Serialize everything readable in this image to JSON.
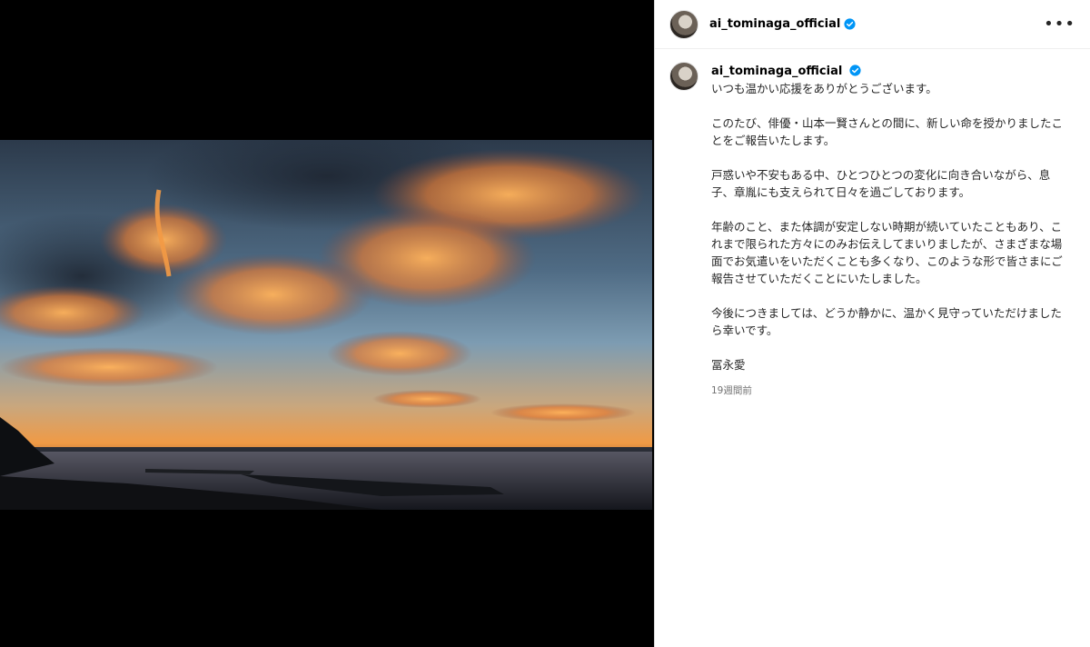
{
  "header": {
    "username": "ai_tominaga_official",
    "more_label": "•••"
  },
  "caption": {
    "username": "ai_tominaga_official",
    "paragraphs": [
      "いつも温かい応援をありがとうございます。",
      "このたび、俳優・山本一賢さんとの間に、新しい命を授かりましたことをご報告いたします。",
      "戸惑いや不安もある中、ひとつひとつの変化に向き合いながら、息子、章胤にも支えられて日々を過ごしております。",
      "年齢のこと、また体調が安定しない時期が続いていたこともあり、これまで限られた方々にのみお伝えしてまいりましたが、さまざまな場面でお気遣いをいただくことも多くなり、このような形で皆さまにご報告させていただくことにいたしました。",
      "今後につきましては、どうか静かに、温かく見守っていただけましたら幸いです。",
      "冨永愛"
    ],
    "timestamp": "19週間前"
  },
  "colors": {
    "verified": "#0095f6",
    "muted": "#737373",
    "text": "#262626"
  }
}
